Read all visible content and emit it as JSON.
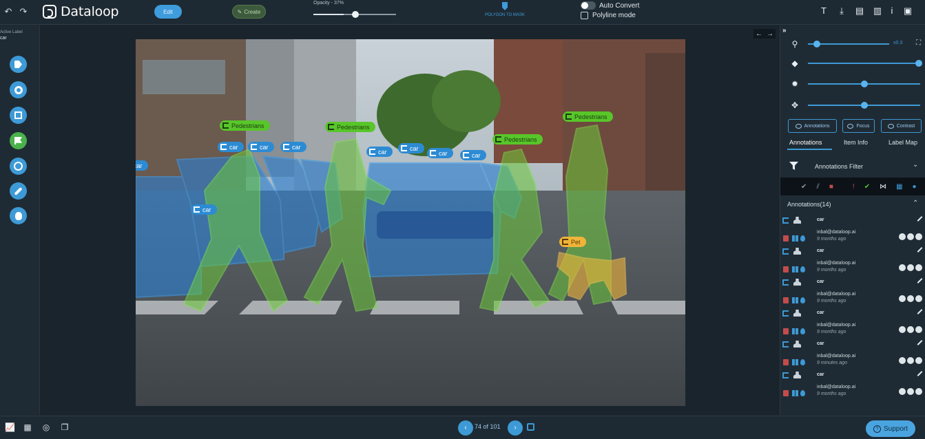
{
  "app": {
    "name": "Dataloop"
  },
  "topbar": {
    "edit_label": "Edit",
    "draw_label": "Create",
    "opacity_label": "Opacity - 37%",
    "opacity_value": 0.37,
    "convert_label": "POLYGON TO MASK",
    "auto_convert_label": "Auto Convert",
    "polyline_label": "Polyline mode",
    "right_icons": [
      "text-icon",
      "download-icon",
      "export-icon",
      "file-icon",
      "info-icon",
      "save-icon"
    ]
  },
  "leftbar": {
    "active_label_title": "Active Label",
    "active_label_value": "car",
    "tools": [
      "tag-tool-icon",
      "point-tool-icon",
      "box-tool-icon",
      "classification-tool-icon",
      "ellipse-tool-icon",
      "brush-tool-icon",
      "bug-tool-icon"
    ]
  },
  "canvas": {
    "labels": [
      {
        "text": "Pedestrians",
        "type": "ped"
      },
      {
        "text": "Pedestrians",
        "type": "ped"
      },
      {
        "text": "Pedestrians",
        "type": "ped"
      },
      {
        "text": "Pedestrians",
        "type": "ped"
      },
      {
        "text": "car",
        "type": "car"
      },
      {
        "text": "car",
        "type": "car"
      },
      {
        "text": "car",
        "type": "car"
      },
      {
        "text": "car",
        "type": "car"
      },
      {
        "text": "car",
        "type": "car"
      },
      {
        "text": "car",
        "type": "car"
      },
      {
        "text": "car",
        "type": "car"
      },
      {
        "text": "car",
        "type": "car"
      },
      {
        "text": "car",
        "type": "car"
      },
      {
        "text": "Pet",
        "type": "pet"
      }
    ]
  },
  "rightpanel": {
    "zoom_value": "x0.3",
    "view_buttons": [
      "Annotations",
      "Focus",
      "Contrast"
    ],
    "tabs": [
      "Annotations",
      "Item Info",
      "Label Map"
    ],
    "filter_label": "Annotations Filter",
    "annotations_header": "Annotations(14)",
    "annotations": [
      {
        "label": "car",
        "user": "inbal@dataloop.ai",
        "time": "9 months ago"
      },
      {
        "label": "car",
        "user": "inbal@dataloop.ai",
        "time": "9 months ago"
      },
      {
        "label": "car",
        "user": "inbal@dataloop.ai",
        "time": "9 months ago"
      },
      {
        "label": "car",
        "user": "inbal@dataloop.ai",
        "time": "9 months ago"
      },
      {
        "label": "car",
        "user": "inbal@dataloop.ai",
        "time": "9 minutes ago"
      },
      {
        "label": "car",
        "user": "inbal@dataloop.ai",
        "time": "9 months ago"
      }
    ]
  },
  "bottombar": {
    "page_counter": "74 of 101",
    "support_label": "Support"
  },
  "colors": {
    "accent": "#3d9ad6",
    "pedestrian": "#58c62a",
    "car": "#2d8bd3",
    "pet": "#f0b43a"
  }
}
